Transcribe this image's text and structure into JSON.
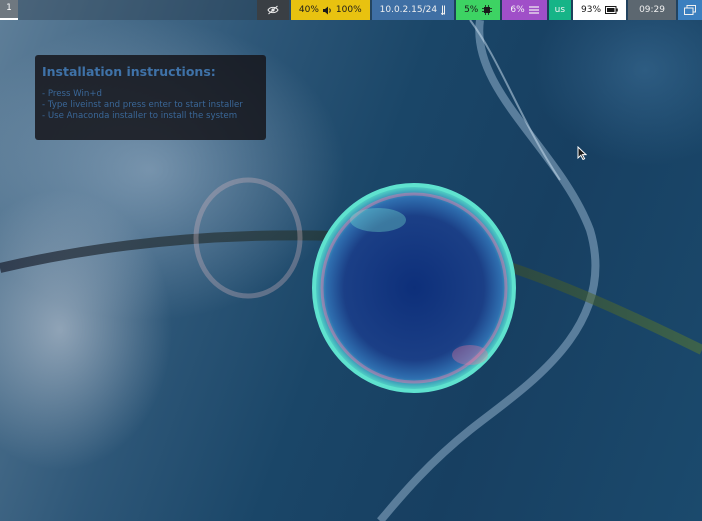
{
  "topbar": {
    "workspace": "1",
    "modules": {
      "privacy_icon": "eye-off-icon",
      "audio": {
        "volume_text": "40%",
        "speaker_icon": "speaker-icon",
        "mic_text": "100%",
        "bg": "#e8c210"
      },
      "network": {
        "text": "10.0.2.15/24",
        "icon": "network-icon",
        "bg": "#3f6fa4"
      },
      "cpu": {
        "text": "5%",
        "icon": "cpu-icon",
        "bg": "#3dd363"
      },
      "memory": {
        "text": "6%",
        "icon": "memory-icon",
        "bg": "#a04fc8"
      },
      "keyboard": {
        "text": "us",
        "bg": "#16b487"
      },
      "battery": {
        "text": "93%",
        "icon": "battery-icon",
        "bg": "#ffffff"
      },
      "clock": {
        "text": "09:29",
        "bg": "#5c6770"
      },
      "tray_icon": "windows-icon"
    }
  },
  "install_box": {
    "title": "Installation instructions:",
    "lines": [
      "- Press   Win+d",
      "- Type   liveinst   and press enter to start installer",
      "- Use Anaconda installer to install the system"
    ]
  },
  "colors": {
    "accent": "#3f72a8"
  }
}
